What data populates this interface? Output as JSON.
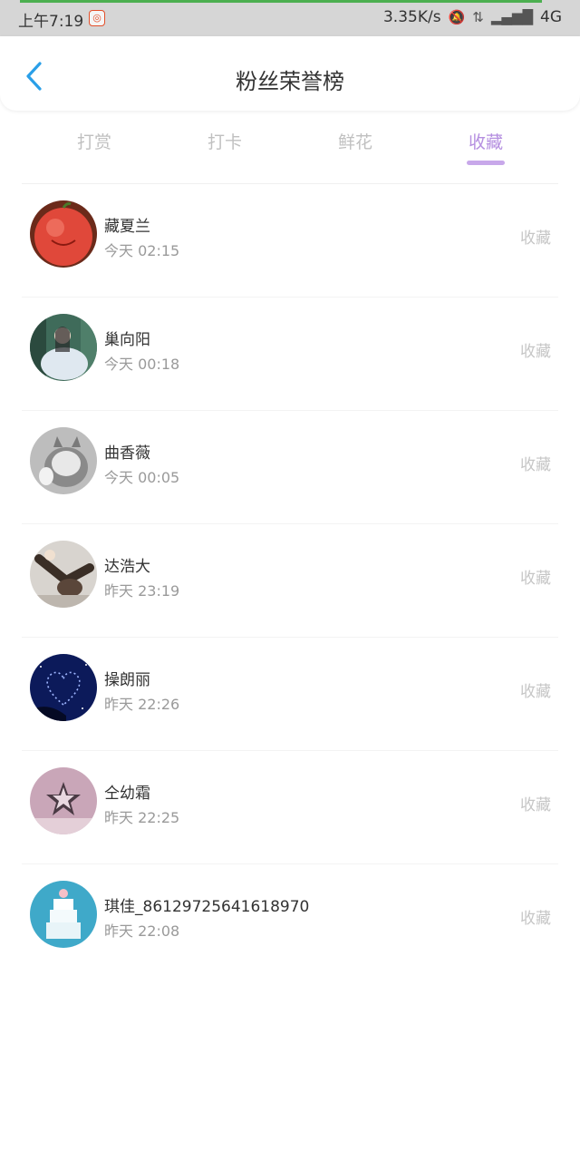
{
  "status_bar": {
    "time": "上午7:19",
    "net_speed": "3.35K/s",
    "network": "4G"
  },
  "header": {
    "title": "粉丝荣誉榜"
  },
  "tabs": [
    {
      "label": "打赏"
    },
    {
      "label": "打卡"
    },
    {
      "label": "鲜花"
    },
    {
      "label": "收藏"
    }
  ],
  "active_tab": "收藏",
  "colors": {
    "accent": "#b58fe0",
    "back_arrow": "#2a9fe8"
  },
  "rows": [
    {
      "name": "藏夏兰",
      "time": "今天 02:15",
      "action": "收藏"
    },
    {
      "name": "巢向阳",
      "time": "今天 00:18",
      "action": "收藏"
    },
    {
      "name": "曲香薇",
      "time": "今天 00:05",
      "action": "收藏"
    },
    {
      "name": "达浩大",
      "time": "昨天 23:19",
      "action": "收藏"
    },
    {
      "name": "操朗丽",
      "time": "昨天 22:26",
      "action": "收藏"
    },
    {
      "name": "仝幼霜",
      "time": "昨天 22:25",
      "action": "收藏"
    },
    {
      "name": "琪佳_86129725641618970",
      "time": "昨天 22:08",
      "action": "收藏"
    }
  ]
}
